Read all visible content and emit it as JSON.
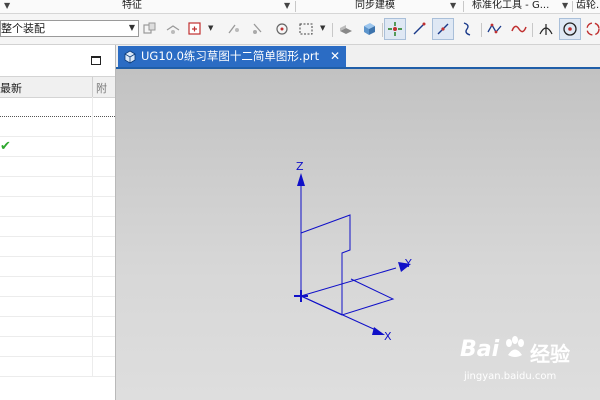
{
  "ribbon_groups": {
    "feature": "特征",
    "sync_modeling": "同步建模",
    "standard_tools": "标准化工具 - G...",
    "gear": "齿轮..."
  },
  "toolbar": {
    "assembly_filter": {
      "value": "整个装配"
    },
    "icons": [
      "assembly-constraint-icon",
      "select-face-icon",
      "snap-point-icon",
      "point-on-curve-icon",
      "move-point-icon",
      "select-region-icon",
      "selection-box-icon",
      "shaded-view-icon",
      "box-3d-icon",
      "snap-all-points-icon",
      "line-icon",
      "tangent-line-icon",
      "arc-icon",
      "spline-icon",
      "wave-curve-icon",
      "intersection-icon",
      "circle-center-icon",
      "rotate-view-icon"
    ]
  },
  "navigator": {
    "col_latest": "最新",
    "col_extra": "附",
    "rows": [
      {
        "latest": ""
      },
      {
        "latest": ""
      },
      {
        "latest": "✔"
      },
      {
        "latest": ""
      },
      {
        "latest": ""
      },
      {
        "latest": ""
      },
      {
        "latest": ""
      },
      {
        "latest": ""
      },
      {
        "latest": ""
      },
      {
        "latest": ""
      },
      {
        "latest": ""
      },
      {
        "latest": ""
      },
      {
        "latest": ""
      },
      {
        "latest": ""
      }
    ]
  },
  "document": {
    "tab_title": "UG10.0练习草图十二简单图形.prt",
    "close_glyph": "✕"
  },
  "viewport": {
    "axis_labels": {
      "x": "X",
      "y": "Y",
      "z": "Z"
    },
    "colors": {
      "geometry": "#1010c8",
      "background_top": "#c2c2c2",
      "background_bottom": "#dedede"
    }
  },
  "watermark": {
    "brand": "Bai",
    "brand_suffix": "经验",
    "url": "jingyan.baidu.com"
  },
  "colors": {
    "tab_active": "#2b6cc4",
    "check": "#2ea82e"
  }
}
